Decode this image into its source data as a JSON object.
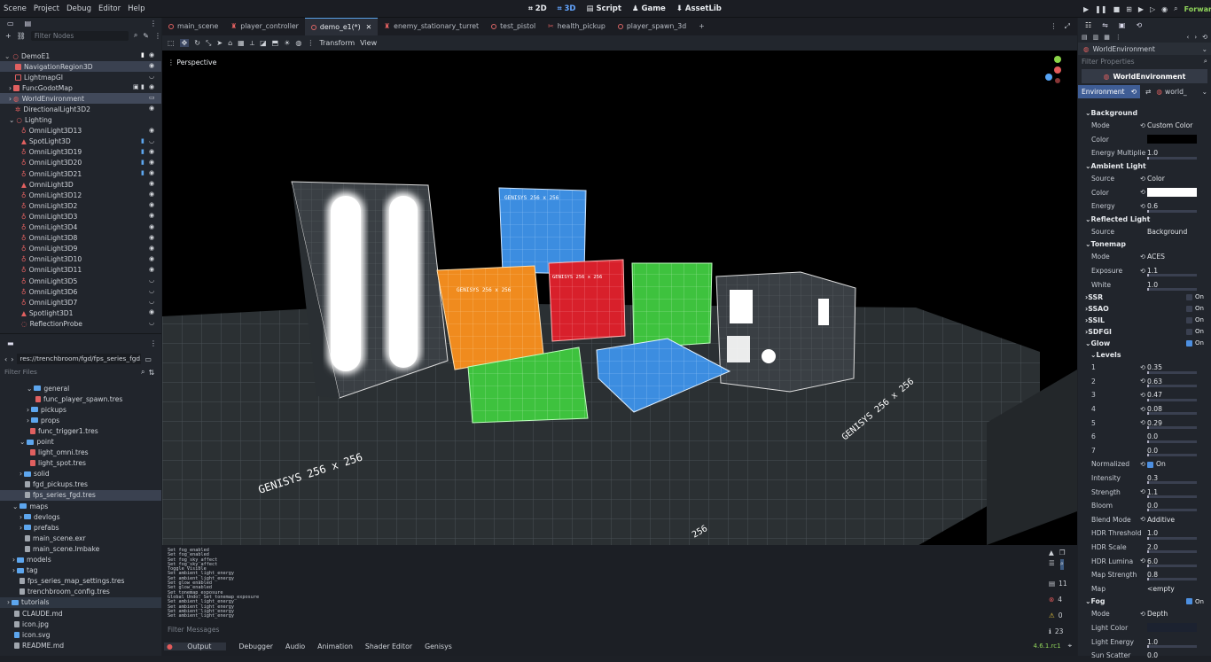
{
  "menu": [
    "Scene",
    "Project",
    "Debug",
    "Editor",
    "Help"
  ],
  "workspaces": [
    "2D",
    "3D",
    "Script",
    "Game",
    "AssetLib"
  ],
  "renderer": "Forward+",
  "scene_tabs": [
    "main_scene",
    "player_controller",
    "demo_e1(*)",
    "enemy_stationary_turret",
    "test_pistol",
    "health_pickup",
    "player_spawn_3d"
  ],
  "scene_filter_placeholder": "Filter Nodes",
  "scene_tree": [
    "DemoE1",
    "NavigationRegion3D",
    "LightmapGI",
    "FuncGodotMap",
    "WorldEnvironment",
    "DirectionalLight3D2",
    "Lighting",
    "OmniLight3D13",
    "SpotLight3D",
    "OmniLight3D19",
    "OmniLight3D20",
    "OmniLight3D21",
    "OmniLight3D",
    "OmniLight3D12",
    "OmniLight3D2",
    "OmniLight3D3",
    "OmniLight3D4",
    "OmniLight3D8",
    "OmniLight3D9",
    "OmniLight3D10",
    "OmniLight3D11",
    "OmniLight3D5",
    "OmniLight3D6",
    "OmniLight3D7",
    "Spotlight3D1",
    "ReflectionProbe"
  ],
  "fs_path": "res://trenchbroom/fgd/fps_series_fgd.tr",
  "fs_filter_placeholder": "Filter Files",
  "fs_items": [
    "general",
    "func_player_spawn.tres",
    "pickups",
    "props",
    "func_trigger1.tres",
    "point",
    "light_omni.tres",
    "light_spot.tres",
    "solid",
    "fgd_pickups.tres",
    "fps_series_fgd.tres",
    "maps",
    "devlogs",
    "prefabs",
    "main_scene.exr",
    "main_scene.lmbake",
    "models",
    "tag",
    "fps_series_map_settings.tres",
    "trenchbroom_config.tres",
    "tutorials",
    "CLAUDE.md",
    "icon.jpg",
    "icon.svg",
    "README.md"
  ],
  "viewport": {
    "toolbar": [
      "Transform",
      "View"
    ],
    "perspective": "Perspective",
    "texture_label": "GENISYS 256 x 256",
    "tile_label": "256"
  },
  "output_lines": [
    "Set fog_enabled",
    "Set fog_enabled",
    "Set fog_sky_affect",
    "Set fog_sky_affect",
    "Toggle Visible",
    "Set ambient_light_energy",
    "Set ambient_light_energy",
    "Set glow_enabled",
    "Set glow_enabled",
    "Set tonemap_exposure",
    "Global Undo: Set tonemap_exposure",
    "Set ambient_light_energy",
    "Set ambient_light_energy",
    "Set ambient_light_energy",
    "Set ambient_light_energy"
  ],
  "output_filter_placeholder": "Filter Messages",
  "output_counts": {
    "a": "11",
    "errors": "4",
    "warnings": "0",
    "messages": "23"
  },
  "bottom_tabs": [
    "Output",
    "Debugger",
    "Audio",
    "Animation",
    "Shader Editor",
    "Genisys"
  ],
  "version": "4.6.1.rc1",
  "inspector": {
    "node": "WorldEnvironment",
    "filter_placeholder": "Filter Properties",
    "header": "WorldEnvironment",
    "prop": "Environment",
    "res": "world_",
    "sections": {
      "background": "Background",
      "ambient": "Ambient Light",
      "reflected": "Reflected Light",
      "tonemap": "Tonemap",
      "ssr": "SSR",
      "ssao": "SSAO",
      "ssil": "SSIL",
      "sdfgi": "SDFGI",
      "glow": "Glow",
      "levels": "Levels",
      "fog": "Fog"
    },
    "bg_mode": "Custom Color",
    "energy_mult": "1.0",
    "amb_source": "Color",
    "amb_energy": "0.6",
    "refl_source": "Background",
    "tm_mode": "ACES",
    "exposure": "1.1",
    "white": "1.0",
    "on": "On",
    "levels": [
      [
        "1",
        "0.35"
      ],
      [
        "2",
        "0.63"
      ],
      [
        "3",
        "0.47"
      ],
      [
        "4",
        "0.08"
      ],
      [
        "5",
        "0.29"
      ],
      [
        "6",
        "0.0"
      ],
      [
        "7",
        "0.0"
      ]
    ],
    "labels": {
      "mode": "Mode",
      "color": "Color",
      "energy_mult": "Energy Multiplie",
      "source": "Source",
      "energy": "Energy",
      "exposure": "Exposure",
      "white": "White",
      "normalized": "Normalized",
      "intensity": "Intensity",
      "strength": "Strength",
      "bloom": "Bloom",
      "blend": "Blend Mode",
      "hdr_th": "HDR Threshold",
      "hdr_sc": "HDR Scale",
      "hdr_lu": "HDR Lumina",
      "map_str": "Map Strength",
      "map": "Map",
      "fog_mode": "Mode",
      "light_color": "Light Color",
      "light_energy": "Light Energy",
      "sun_scatter": "Sun Scatter"
    },
    "glow": {
      "intensity": "0.3",
      "strength": "1.1",
      "bloom": "0.0",
      "blend": "Additive",
      "hdr_th": "1.0",
      "hdr_sc": "2.0",
      "hdr_lu": "6.0",
      "map_str": "0.8",
      "map": "<empty"
    },
    "fog": {
      "mode": "Depth",
      "light_energy": "1.0",
      "sun_scatter": "0.0"
    }
  }
}
